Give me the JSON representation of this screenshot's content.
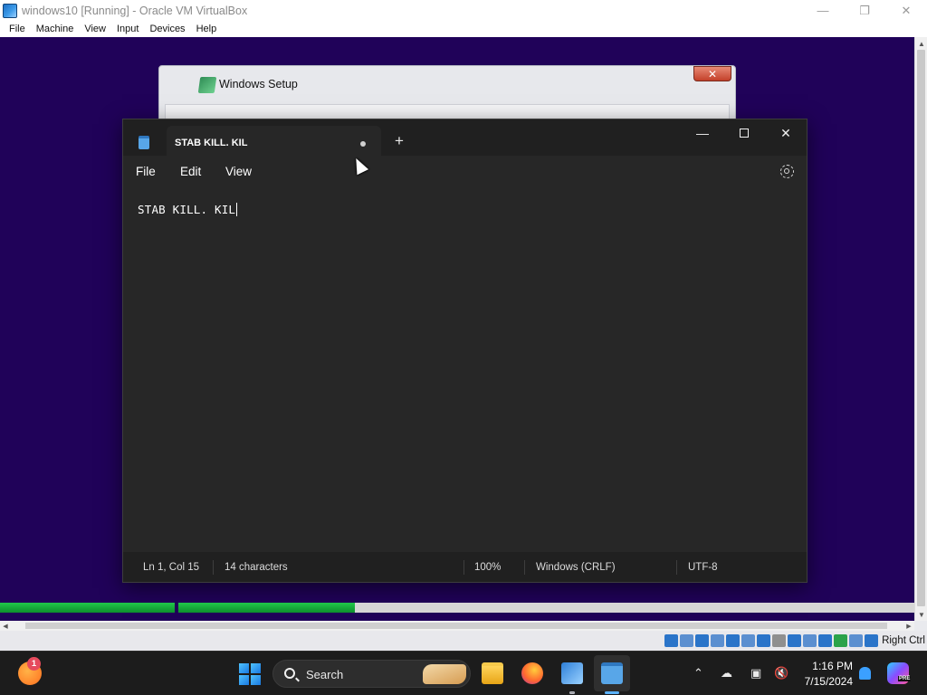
{
  "host": {
    "title": "windows10 [Running] - Oracle VM VirtualBox",
    "menu": [
      "File",
      "Machine",
      "View",
      "Input",
      "Devices",
      "Help"
    ],
    "status": {
      "host_key": "Right Ctrl"
    },
    "colors": {
      "guest_background": "#200259"
    }
  },
  "setup_window": {
    "title": "Windows Setup"
  },
  "notepad": {
    "tab_title": "STAB KILL. KIL",
    "menu": [
      "File",
      "Edit",
      "View"
    ],
    "content": "STAB KILL. KIL",
    "status": {
      "position": "Ln 1, Col 15",
      "characters": "14 characters",
      "zoom": "100%",
      "line_ending": "Windows (CRLF)",
      "encoding": "UTF-8"
    }
  },
  "taskbar": {
    "weather_badge": "1",
    "search_label": "Search",
    "time": "1:16 PM",
    "date": "7/15/2024",
    "copilot_badge": "PRE"
  }
}
